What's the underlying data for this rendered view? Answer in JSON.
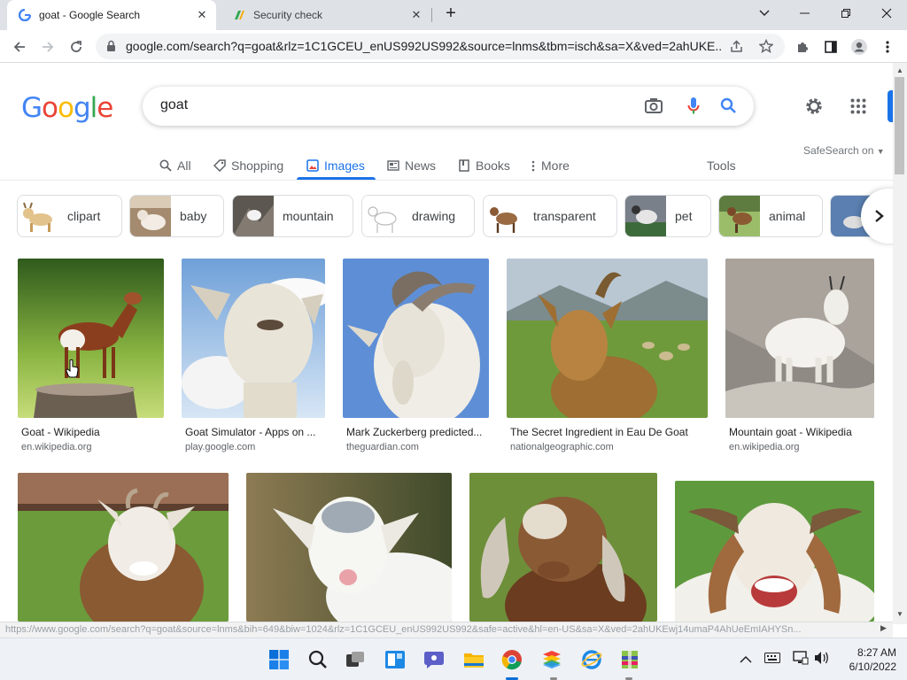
{
  "browser": {
    "tabs": [
      {
        "title": "goat - Google Search",
        "active": true,
        "icon": "google-g-icon"
      },
      {
        "title": "Security check",
        "active": false,
        "icon": "secure-shield-icon"
      }
    ],
    "new_tab_symbol": "+",
    "url": "google.com/search?q=goat&rlz=1C1GCEU_enUS992US992&source=lnms&tbm=isch&sa=X&ved=2ahUKE...",
    "status_url": "https://www.google.com/search?q=goat&source=lnms&bih=649&biw=1024&rlz=1C1GCEU_enUS992US992&safe=active&hl=en-US&sa=X&ved=2ahUKEwj14umaP4AhUeEmIAHYSn..."
  },
  "google": {
    "logo_letters": [
      "G",
      "o",
      "o",
      "g",
      "l",
      "e"
    ],
    "logo_colors": [
      "#4285F4",
      "#EA4335",
      "#FBBC05",
      "#4285F4",
      "#34A853",
      "#EA4335"
    ],
    "query": "goat",
    "nav": [
      {
        "label": "All",
        "icon": "search-icon"
      },
      {
        "label": "Shopping",
        "icon": "tag-icon"
      },
      {
        "label": "Images",
        "icon": "image-icon",
        "active": true
      },
      {
        "label": "News",
        "icon": "news-icon"
      },
      {
        "label": "Books",
        "icon": "book-icon"
      },
      {
        "label": "More",
        "icon": "more-vertical-icon"
      }
    ],
    "tools": "Tools",
    "safesearch": "SafeSearch on"
  },
  "chips": [
    {
      "label": "clipart",
      "color": "#d9c7a8"
    },
    {
      "label": "baby",
      "color": "#b8a48b"
    },
    {
      "label": "mountain",
      "color": "#6f6a63"
    },
    {
      "label": "drawing",
      "color": "#ececec"
    },
    {
      "label": "transparent",
      "color": "#a4744c"
    },
    {
      "label": "pet",
      "color": "#8a8f96"
    },
    {
      "label": "animal",
      "color": "#8ba35c"
    }
  ],
  "results": [
    {
      "title": "Goat - Wikipedia",
      "source": "en.wikipedia.org"
    },
    {
      "title": "Goat Simulator - Apps on ...",
      "source": "play.google.com"
    },
    {
      "title": "Mark Zuckerberg predicted...",
      "source": "theguardian.com"
    },
    {
      "title": "The Secret Ingredient in Eau De Goat",
      "source": "nationalgeographic.com"
    },
    {
      "title": "Mountain goat - Wikipedia",
      "source": "en.wikipedia.org"
    }
  ],
  "taskbar": {
    "time": "8:27 AM",
    "date": "6/10/2022"
  }
}
